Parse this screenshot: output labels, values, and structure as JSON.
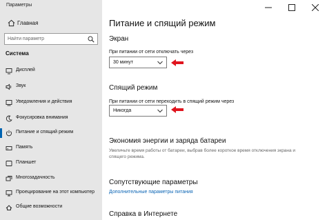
{
  "window": {
    "title": "Параметры"
  },
  "sidebar": {
    "home_label": "Главная",
    "search_placeholder": "Найти параметр",
    "section_title": "Система",
    "items": [
      {
        "label": "Дисплей",
        "icon": "display-icon"
      },
      {
        "label": "Звук",
        "icon": "speaker-icon"
      },
      {
        "label": "Уведомления и действия",
        "icon": "notifications-icon"
      },
      {
        "label": "Фокусировка внимания",
        "icon": "moon-icon"
      },
      {
        "label": "Питание и спящий режим",
        "icon": "power-icon",
        "active": true
      },
      {
        "label": "Память",
        "icon": "storage-icon"
      },
      {
        "label": "Планшет",
        "icon": "tablet-icon"
      },
      {
        "label": "Многозадачность",
        "icon": "multitasking-icon"
      },
      {
        "label": "Проецирование на этот компьютер",
        "icon": "projecting-icon"
      },
      {
        "label": "Общие возможности",
        "icon": "shared-experiences-icon"
      }
    ]
  },
  "main": {
    "title": "Питание и спящий режим",
    "screen": {
      "heading": "Экран",
      "label": "При питании от сети отключать через",
      "value": "30 минут"
    },
    "sleep": {
      "heading": "Спящий режим",
      "label": "При питании от сети переходить в спящий режим через",
      "value": "Никогда"
    },
    "battery": {
      "heading": "Экономия энергии и заряда батареи",
      "description": "Увеличьте время работы от батареи, выбрав более короткое время отключения экрана и спящего режима."
    },
    "related": {
      "heading": "Сопутствующие параметры",
      "link": "Дополнительные параметры питания"
    },
    "help": {
      "heading": "Справка в Интернете"
    }
  },
  "colors": {
    "accent": "#0063b1",
    "link": "#0a64b4",
    "sidebar_bg": "#e6e6e6",
    "annotation_arrow": "#e0141e"
  }
}
